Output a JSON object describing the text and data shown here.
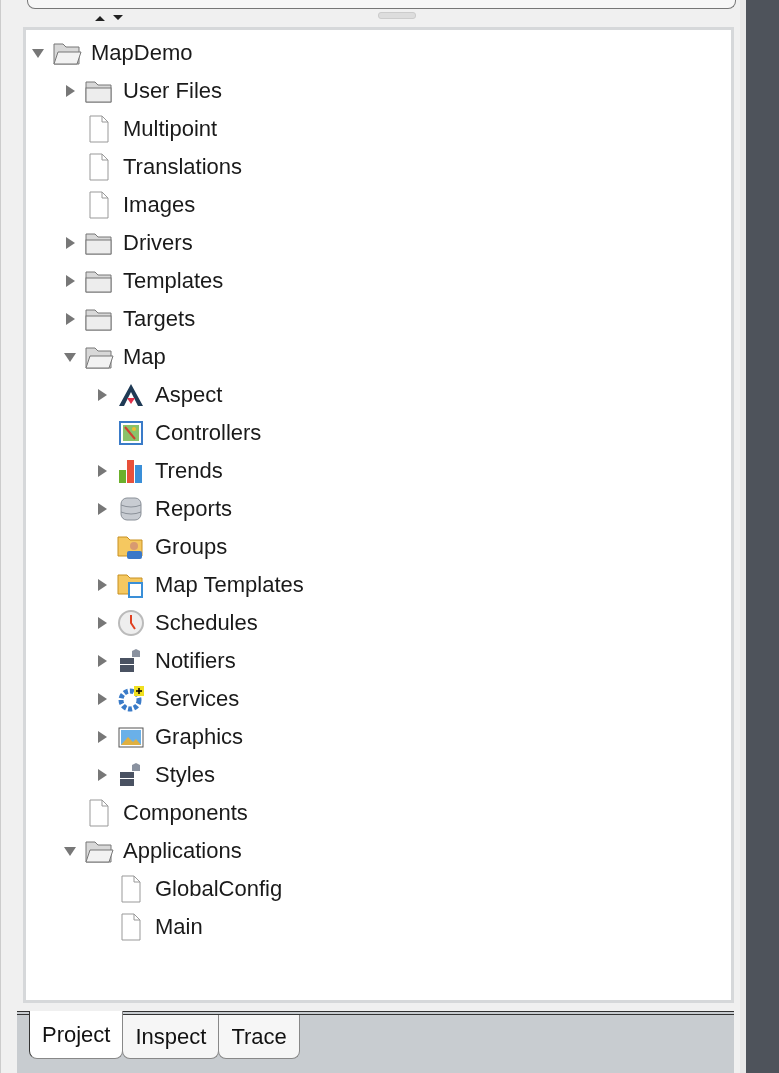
{
  "tree": [
    {
      "label": "MapDemo",
      "kind": "folder",
      "expanded": true,
      "children": [
        {
          "label": "User Files",
          "kind": "folder",
          "expanded": false
        },
        {
          "label": "Multipoint",
          "kind": "file"
        },
        {
          "label": "Translations",
          "kind": "file"
        },
        {
          "label": "Images",
          "kind": "file"
        },
        {
          "label": "Drivers",
          "kind": "folder",
          "expanded": false
        },
        {
          "label": "Templates",
          "kind": "folder",
          "expanded": false
        },
        {
          "label": "Targets",
          "kind": "folder",
          "expanded": false
        },
        {
          "label": "Map",
          "kind": "folder",
          "expanded": true,
          "children": [
            {
              "label": "Aspect",
              "kind": "aspect",
              "expanded": false
            },
            {
              "label": "Controllers",
              "kind": "controllers"
            },
            {
              "label": "Trends",
              "kind": "trends",
              "expanded": false
            },
            {
              "label": "Reports",
              "kind": "reports",
              "expanded": false
            },
            {
              "label": "Groups",
              "kind": "groups"
            },
            {
              "label": "Map Templates",
              "kind": "map-templates",
              "expanded": false
            },
            {
              "label": "Schedules",
              "kind": "schedules",
              "expanded": false
            },
            {
              "label": "Notifiers",
              "kind": "notifiers",
              "expanded": false
            },
            {
              "label": "Services",
              "kind": "services",
              "expanded": false
            },
            {
              "label": "Graphics",
              "kind": "graphics",
              "expanded": false
            },
            {
              "label": "Styles",
              "kind": "notifiers",
              "expanded": false
            }
          ]
        },
        {
          "label": "Components",
          "kind": "file"
        },
        {
          "label": "Applications",
          "kind": "folder",
          "expanded": true,
          "children": [
            {
              "label": "GlobalConfig",
              "kind": "file"
            },
            {
              "label": "Main",
              "kind": "file"
            }
          ]
        }
      ]
    }
  ],
  "tabs": [
    {
      "label": "Project",
      "selected": true
    },
    {
      "label": "Inspect",
      "selected": false
    },
    {
      "label": "Trace",
      "selected": false
    }
  ]
}
